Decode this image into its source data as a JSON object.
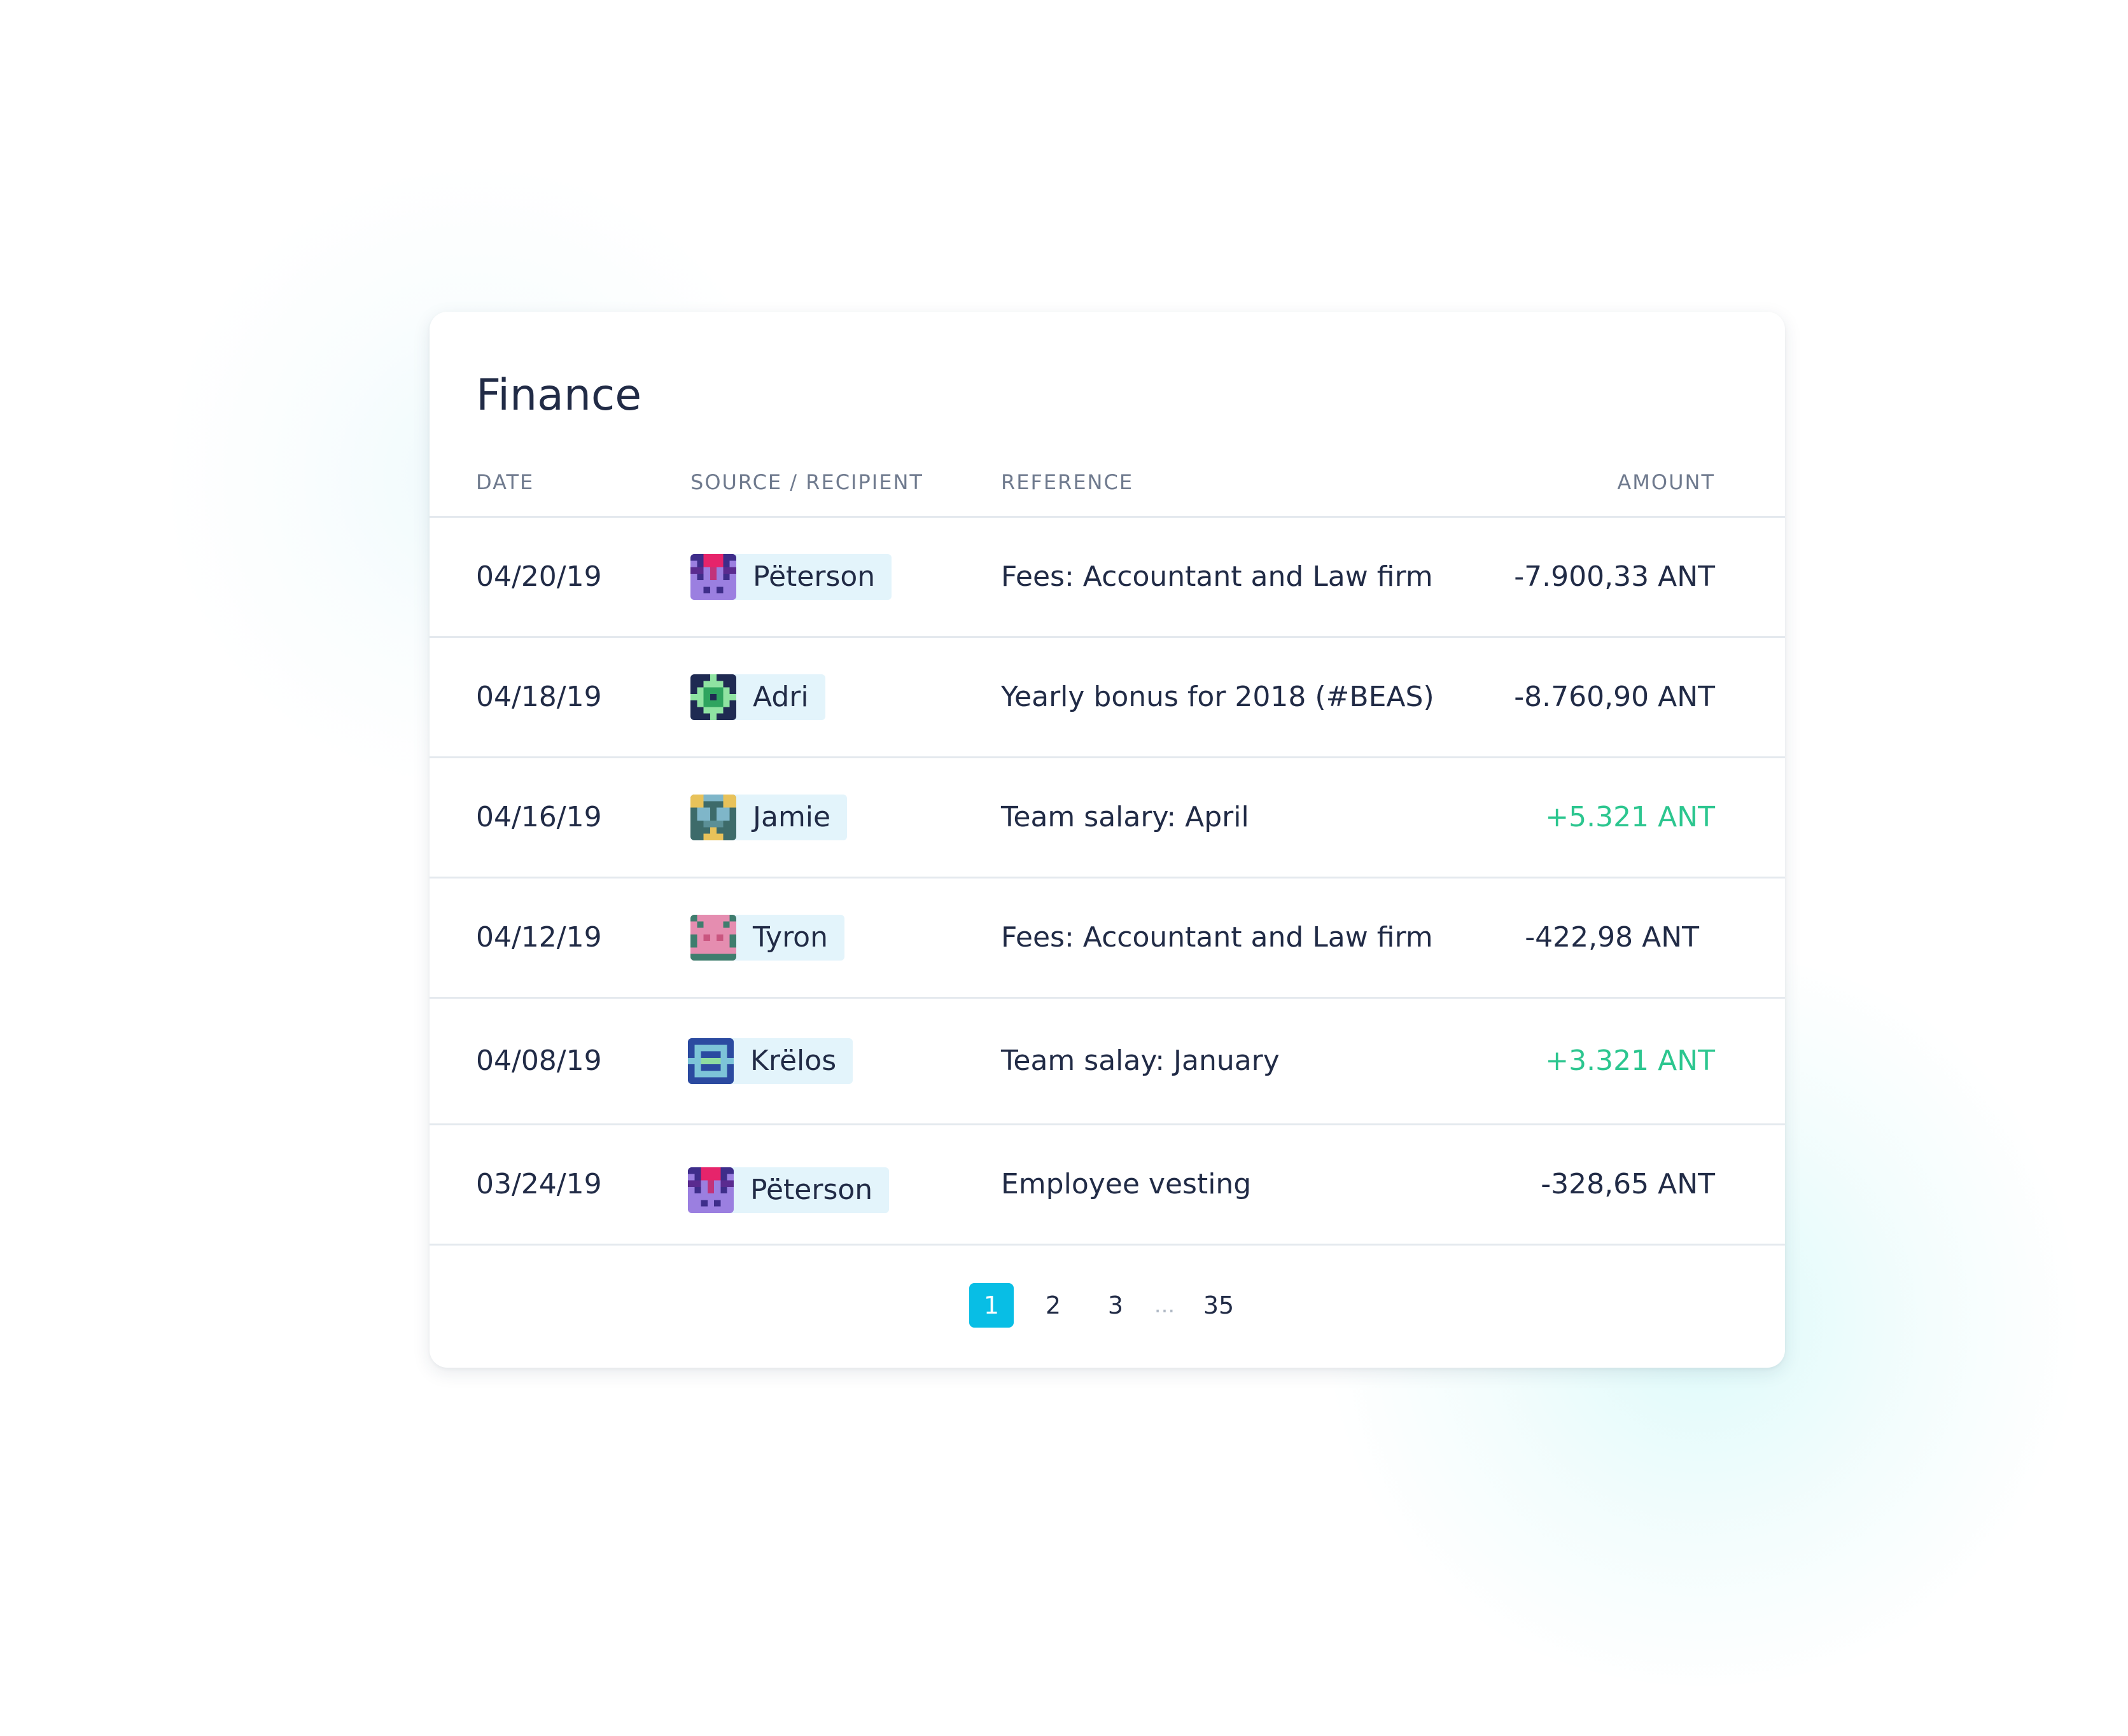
{
  "title": "Finance",
  "columns": {
    "date": "DATE",
    "source": "SOURCE / RECIPIENT",
    "reference": "REFERENCE",
    "amount": "AMOUNT"
  },
  "colors": {
    "positive_amount": "#2cc68f",
    "default_text": "#212b46",
    "header_text": "#6f7a8e",
    "active_page": "#08bee5",
    "recipient_badge": "#e3f4fb"
  },
  "transactions": [
    {
      "date": "04/20/19",
      "recipient": "Pëterson",
      "reference": "Fees: Accountant and Law firm",
      "amount": "-7.900,33 ANT"
    },
    {
      "date": "04/18/19",
      "recipient": "Adri",
      "reference": "Yearly bonus for 2018 (#BEAS)",
      "amount": "-8.760,90 ANT"
    },
    {
      "date": "04/16/19",
      "recipient": "Jamie",
      "reference": "Team salary: April",
      "amount": "+5.321 ANT"
    },
    {
      "date": "04/12/19",
      "recipient": "Tyron",
      "reference": "Fees: Accountant and Law firm",
      "amount": "-422,98 ANT"
    },
    {
      "date": "04/08/19",
      "recipient": "Krëlos",
      "reference": "Team salay: January",
      "amount": "+3.321 ANT"
    },
    {
      "date": "03/24/19",
      "recipient": "Pëterson",
      "reference": "Employee vesting",
      "amount": "-328,65 ANT"
    }
  ],
  "pagination": {
    "pages": [
      "1",
      "2",
      "3"
    ],
    "ellipsis": "...",
    "last_page": "35",
    "current": "1"
  }
}
